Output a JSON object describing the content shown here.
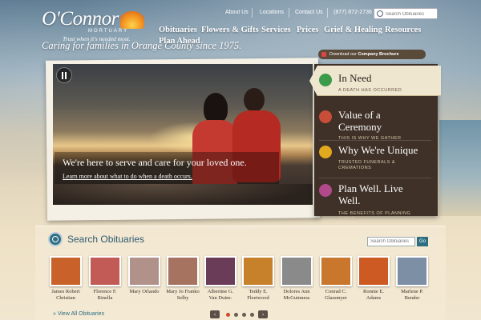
{
  "brand": {
    "name": "O'Connor",
    "sub": "MORTUARY",
    "tagline": "Trust when it's needed most.",
    "caring": "Caring for families in Orange County since 1975."
  },
  "utility": {
    "about": "About Us",
    "locations": "Locations",
    "contact": "Contact Us",
    "phone": "(877) 872-2736",
    "search_placeholder": "Search Obituaries"
  },
  "nav": [
    "Obituaries",
    "Flowers & Gifts",
    "Services",
    "Prices",
    "Grief & Healing",
    "Resources",
    "Plan Ahead"
  ],
  "brochure": {
    "label": "Download our",
    "bold": "Company Brochure"
  },
  "hero": {
    "headline": "We're here to serve and care for your loved one.",
    "link": "Learn more about what to do when a death occurs."
  },
  "panel": {
    "items": [
      {
        "title": "In Need",
        "sub": "A DEATH HAS OCCURRED",
        "icon": "check-icon",
        "color": "#3d9a4a"
      },
      {
        "title": "Value of a Ceremony",
        "sub": "THIS IS WHY WE GATHER",
        "icon": "certificate-icon",
        "color": "#c94e3a"
      },
      {
        "title": "Why We're Unique",
        "sub": "TRUSTED FUNERALS & CREMATIONS",
        "icon": "flower-icon",
        "color": "#e2a81e"
      },
      {
        "title": "Plan Well. Live Well.",
        "sub": "THE BENEFITS OF PLANNING AHEAD",
        "icon": "butterfly-icon",
        "color": "#b04a8a"
      }
    ]
  },
  "obituaries": {
    "title": "Search Obituaries",
    "search_placeholder": "Search Obituaries",
    "go": "Go",
    "view_all": "» View All Obituaries",
    "people": [
      {
        "name": "James Robert Christian",
        "tone": "#c8622a"
      },
      {
        "name": "Florence F. Rinella",
        "tone": "#c25a55"
      },
      {
        "name": "Mary Orlando",
        "tone": "#b0928a"
      },
      {
        "name": "Mary Jo Franko Selby",
        "tone": "#a67360"
      },
      {
        "name": "Albertine G. Van Duim-",
        "tone": "#6b3c58"
      },
      {
        "name": "Teddy E. Fleetwood",
        "tone": "#c7812a"
      },
      {
        "name": "Dolores Ann McGuinness",
        "tone": "#8a8a8a"
      },
      {
        "name": "Conrad C. Glassmyer",
        "tone": "#c9772c"
      },
      {
        "name": "Ronnie E. Adams",
        "tone": "#cc5a22"
      },
      {
        "name": "Marlene P. Bender",
        "tone": "#7d8fa5"
      }
    ]
  }
}
